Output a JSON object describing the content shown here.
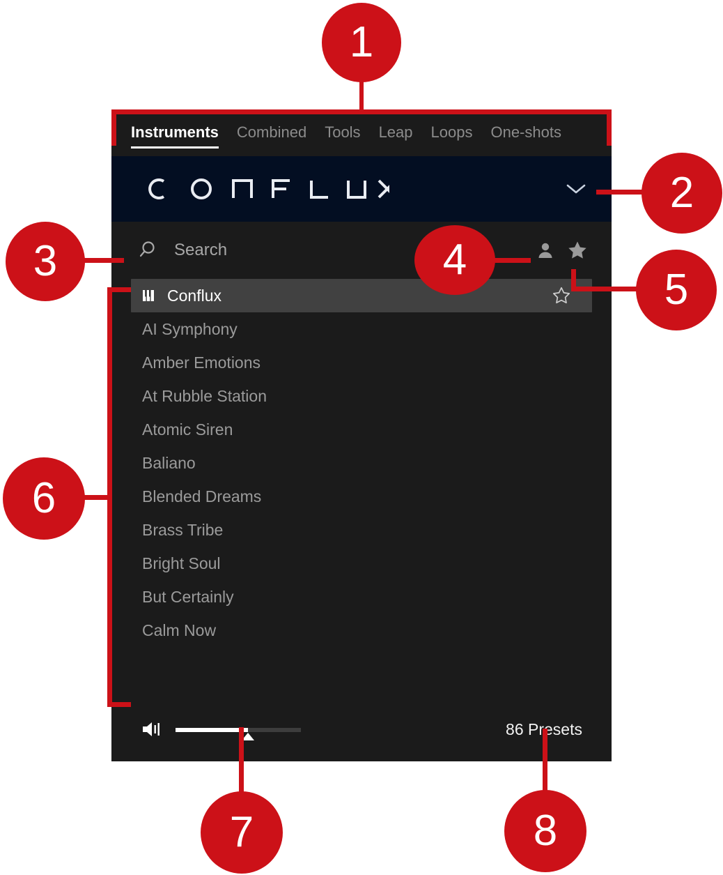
{
  "panel": {
    "tabs": [
      {
        "label": "Instruments",
        "active": true
      },
      {
        "label": "Combined",
        "active": false
      },
      {
        "label": "Tools",
        "active": false
      },
      {
        "label": "Leap",
        "active": false
      },
      {
        "label": "Loops",
        "active": false
      },
      {
        "label": "One-shots",
        "active": false
      }
    ],
    "product": {
      "name": "CONFLUX",
      "expand_icon": "chevron-down-icon",
      "header_color": "#030e22"
    },
    "search": {
      "icon": "search-icon",
      "placeholder": "Search",
      "value": "",
      "user_icon": "user-icon",
      "favorites_icon": "star-filled-icon"
    },
    "list": {
      "selected_item": {
        "label": "Conflux",
        "icon": "piano-keys-icon",
        "favorite_icon": "star-outline-icon",
        "favorited": false
      },
      "items": [
        {
          "label": "AI Symphony"
        },
        {
          "label": "Amber Emotions"
        },
        {
          "label": "At Rubble Station"
        },
        {
          "label": "Atomic Siren"
        },
        {
          "label": "Baliano"
        },
        {
          "label": "Blended Dreams"
        },
        {
          "label": "Brass Tribe"
        },
        {
          "label": "Bright Soul"
        },
        {
          "label": "But Certainly"
        },
        {
          "label": "Calm Now"
        }
      ]
    },
    "footer": {
      "volume_icon": "speaker-volume-icon",
      "volume_percent": 58,
      "preset_count_label": "86 Presets"
    }
  },
  "callouts": {
    "accent_color": "#cc1118",
    "items": [
      {
        "number": "1",
        "target": "tab-bar"
      },
      {
        "number": "2",
        "target": "product-expand-chevron"
      },
      {
        "number": "3",
        "target": "search-field"
      },
      {
        "number": "4",
        "target": "user-icon"
      },
      {
        "number": "5",
        "target": "favorites-star-icon"
      },
      {
        "number": "6",
        "target": "preset-list"
      },
      {
        "number": "7",
        "target": "volume-slider-knob"
      },
      {
        "number": "8",
        "target": "preset-count"
      }
    ]
  }
}
